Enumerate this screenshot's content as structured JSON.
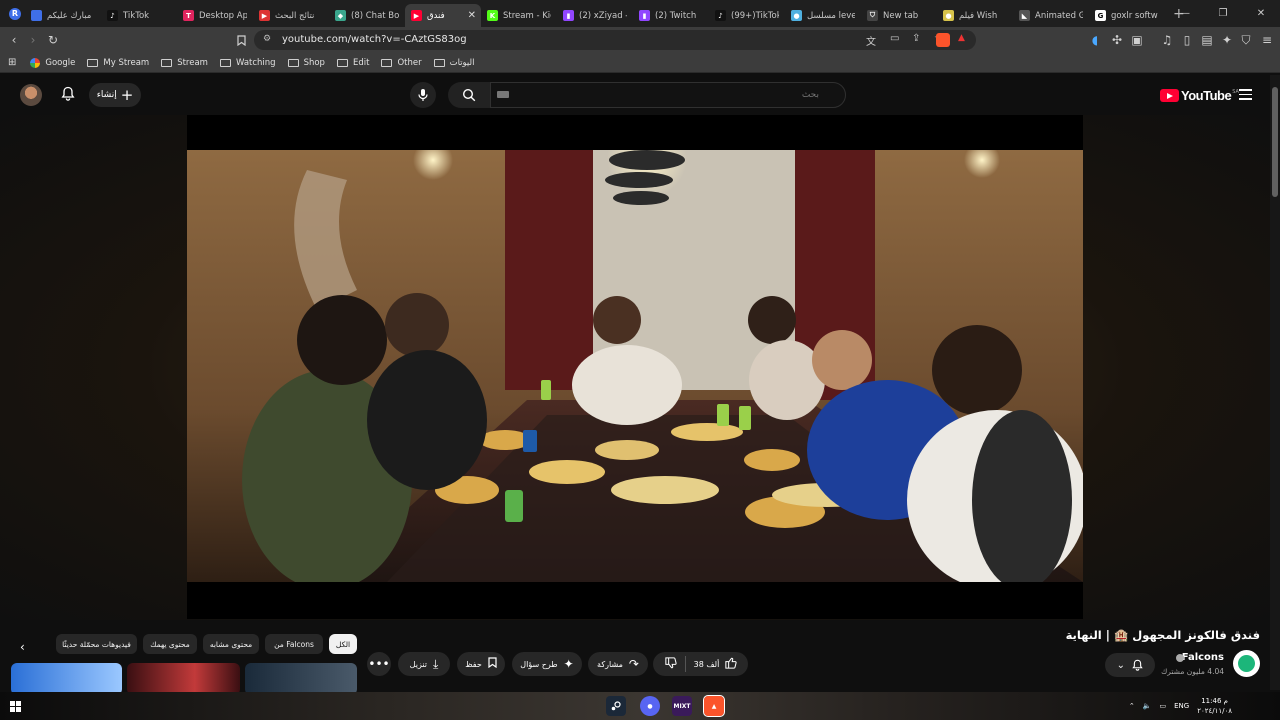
{
  "browser": {
    "profile_initial": "R",
    "tabs": [
      {
        "label": "مبارك عليكم",
        "fav": "",
        "fav_color": "#3f6fe8",
        "active": false
      },
      {
        "label": "TikTok",
        "fav": "♪",
        "fav_color": "#111111",
        "active": false
      },
      {
        "label": "Desktop Ap",
        "fav": "T",
        "fav_color": "#e0245e",
        "active": false
      },
      {
        "label": "نتائج البحث",
        "fav": "▶",
        "fav_color": "#d33",
        "active": false
      },
      {
        "label": "(8) Chat Box",
        "fav": "◆",
        "fav_color": "#3aa68d",
        "active": false
      },
      {
        "label": "فندق",
        "fav": "▶",
        "fav_color": "#ff0033",
        "active": true
      },
      {
        "label": "Stream - Kic",
        "fav": "K",
        "fav_color": "#53fc18",
        "active": false
      },
      {
        "label": "(2) xZiyad -",
        "fav": "▮",
        "fav_color": "#9146ff",
        "active": false
      },
      {
        "label": "(2) Twitch",
        "fav": "▮",
        "fav_color": "#9146ff",
        "active": false
      },
      {
        "label": "(99+)TikTok",
        "fav": "♪",
        "fav_color": "#111111",
        "active": false
      },
      {
        "label": "مسلسل level",
        "fav": "●",
        "fav_color": "#4fb0e0",
        "active": false
      },
      {
        "label": "New tab",
        "fav": "⛉",
        "fav_color": "#444444",
        "active": false
      },
      {
        "label": "فيلم Wish",
        "fav": "●",
        "fav_color": "#d6c24a",
        "active": false
      },
      {
        "label": "Animated G",
        "fav": "◣",
        "fav_color": "#555555",
        "active": false
      },
      {
        "label": "goxlr softw",
        "fav": "G",
        "fav_color": "#ffffff",
        "active": false
      }
    ],
    "new_tab_label": "+",
    "url": "youtube.com/watch?v=-CAztGS83og",
    "bookmarks": [
      "Google",
      "My Stream",
      "Stream",
      "Watching",
      "Shop",
      "Edit",
      "Other",
      "اليوتات"
    ]
  },
  "youtube": {
    "create_label": "إنشاء",
    "search_placeholder": "بحث",
    "logo_text": "YouTube",
    "region": "SA",
    "video_title": "فندق فالكونز المجهول 🏨 | النهاية",
    "channel_name": "Falcons",
    "subscribers": "4.04 مليون مشترك",
    "likes": "38 ألف",
    "actions": {
      "share": "مشاركة",
      "ask": "طرح سؤال",
      "save": "حفظ",
      "download": "تنزيل"
    },
    "chips": [
      "الكل",
      "من Falcons",
      "محتوى مشابه",
      "محتوى يهمك",
      "فيديوهات محمّلة حديثًا"
    ]
  },
  "taskbar": {
    "apps": [
      "steam",
      "discord",
      "mixitup",
      "brave"
    ],
    "app_labels": [
      "",
      "",
      "MIXT",
      ""
    ],
    "language": "ENG",
    "time": "11:46 م",
    "date": "٢٠٢٤/١١/٠٨"
  },
  "colors": {
    "yt_red": "#ff0033",
    "background": "#0f0f0f",
    "chip_bg": "#272727"
  }
}
